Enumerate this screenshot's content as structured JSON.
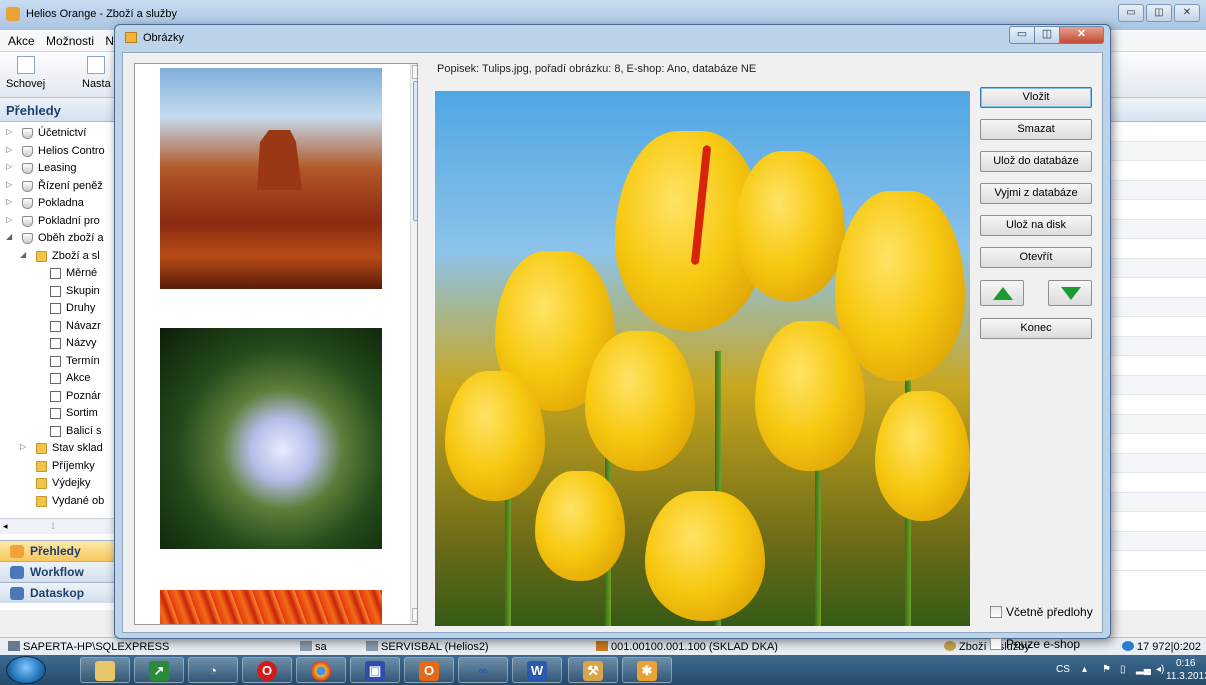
{
  "app": {
    "title": "Helios Orange - Zboží a služby",
    "menu": [
      "Akce",
      "Možnosti",
      "N"
    ],
    "toolbar": {
      "schovej": "Schovej",
      "nast": "Nasta"
    },
    "left_header": "Přehledy",
    "tree": [
      {
        "label": "Účetnictví",
        "indent": 0,
        "icon": "db",
        "tri": "▷"
      },
      {
        "label": "Helios Contro",
        "indent": 0,
        "icon": "db",
        "tri": "▷"
      },
      {
        "label": "Leasing",
        "indent": 0,
        "icon": "db",
        "tri": "▷"
      },
      {
        "label": "Řízení peněž",
        "indent": 0,
        "icon": "db",
        "tri": "▷"
      },
      {
        "label": "Pokladna",
        "indent": 0,
        "icon": "db",
        "tri": "▷"
      },
      {
        "label": "Pokladní pro",
        "indent": 0,
        "icon": "db",
        "tri": "▷"
      },
      {
        "label": "Oběh zboží a",
        "indent": 0,
        "icon": "db",
        "tri": "◢"
      },
      {
        "label": "Zboží a sl",
        "indent": 1,
        "icon": "folder",
        "tri": "◢"
      },
      {
        "label": "Měrné",
        "indent": 2,
        "icon": "page",
        "tri": ""
      },
      {
        "label": "Skupin",
        "indent": 2,
        "icon": "page",
        "tri": ""
      },
      {
        "label": "Druhy",
        "indent": 2,
        "icon": "page",
        "tri": ""
      },
      {
        "label": "Návazr",
        "indent": 2,
        "icon": "page",
        "tri": ""
      },
      {
        "label": "Názvy",
        "indent": 2,
        "icon": "page",
        "tri": ""
      },
      {
        "label": "Termín",
        "indent": 2,
        "icon": "page",
        "tri": ""
      },
      {
        "label": "Akce",
        "indent": 2,
        "icon": "page",
        "tri": ""
      },
      {
        "label": "Poznár",
        "indent": 2,
        "icon": "page",
        "tri": ""
      },
      {
        "label": "Sortim",
        "indent": 2,
        "icon": "page",
        "tri": ""
      },
      {
        "label": "Balicí s",
        "indent": 2,
        "icon": "page",
        "tri": ""
      },
      {
        "label": "Stav sklad",
        "indent": 1,
        "icon": "folder",
        "tri": "▷"
      },
      {
        "label": "Příjemky",
        "indent": 1,
        "icon": "folder",
        "tri": ""
      },
      {
        "label": "Výdejky",
        "indent": 1,
        "icon": "folder",
        "tri": ""
      },
      {
        "label": "Vydané ob",
        "indent": 1,
        "icon": "folder",
        "tri": ""
      }
    ],
    "nav_panes": [
      {
        "label": "Přehledy",
        "active": true
      },
      {
        "label": "Workflow",
        "active": false
      },
      {
        "label": "Dataskop",
        "active": false
      }
    ],
    "status": {
      "server": "SAPERTA-HP\\SQLEXPRESS",
      "user": "sa",
      "db": "SERVISBAL (Helios2)",
      "warehouse": "001.00100.001.100 (SKLAD DKA)",
      "module": "Zboží a služby",
      "counter": "17 972|0:202"
    }
  },
  "dialog": {
    "title": "Obrázky",
    "caption": "Popisek: Tulips.jpg, pořadí obrázku: 8, E-shop: Ano,  databáze NE",
    "buttons": {
      "vlozit": "Vložit",
      "smazat": "Smazat",
      "uloz_db": "Ulož do databáze",
      "vyjmi_db": "Vyjmi z databáze",
      "uloz_disk": "Ulož na disk",
      "otevrit": "Otevřít",
      "konec": "Konec"
    },
    "checkboxes": {
      "vcetne": "Včetně předlohy",
      "pouze": "Pouze e-shop"
    }
  },
  "taskbar": {
    "lang": "CS",
    "time": "0:16",
    "date": "11.3.2013"
  }
}
